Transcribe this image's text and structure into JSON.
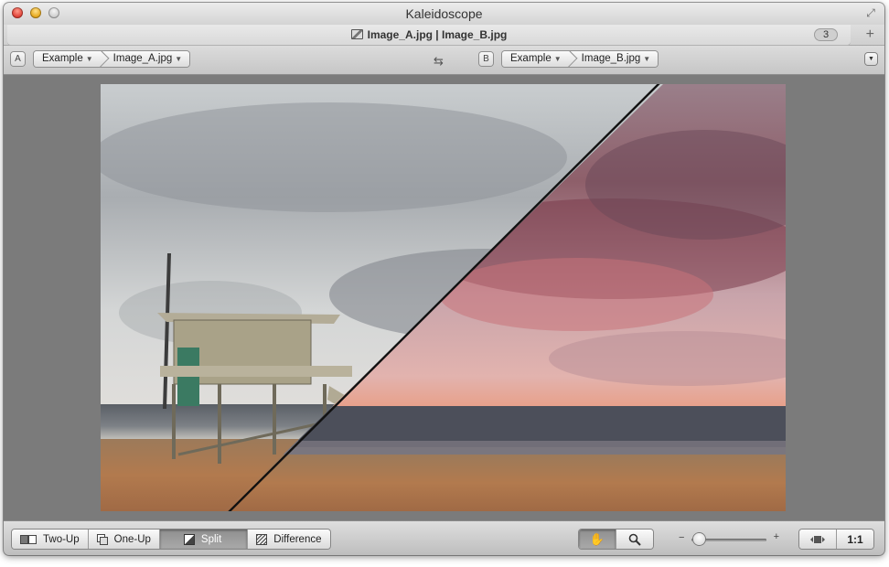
{
  "window": {
    "title": "Kaleidoscope"
  },
  "tab": {
    "title": "Image_A.jpg | Image_B.jpg",
    "count": "3",
    "add_icon": "plus-icon"
  },
  "left": {
    "badge": "A",
    "crumbs": [
      "Example",
      "Image_A.jpg"
    ]
  },
  "right": {
    "badge": "B",
    "crumbs": [
      "Example",
      "Image_B.jpg"
    ]
  },
  "swap_icon": "swap-arrows-icon",
  "modes": [
    {
      "label": "Two-Up",
      "icon": "two-up-icon",
      "active": false
    },
    {
      "label": "One-Up",
      "icon": "one-up-icon",
      "active": false
    },
    {
      "label": "Split",
      "icon": "split-icon",
      "active": true
    },
    {
      "label": "Difference",
      "icon": "difference-icon",
      "active": false
    }
  ],
  "tools": [
    {
      "icon": "hand-icon",
      "active": true
    },
    {
      "icon": "magnifier-icon",
      "active": false
    }
  ],
  "zoom": {
    "level": 0.1,
    "minus": "−",
    "plus": "+"
  },
  "fit": {
    "icon": "fit-to-window-icon",
    "actual_size": "1:1"
  },
  "colors": {
    "active_segment": "#999999",
    "content_bg": "#7b7b7b",
    "close": "#e0443a",
    "minimize": "#e6a91f",
    "zoom": "#cfcfcf"
  }
}
